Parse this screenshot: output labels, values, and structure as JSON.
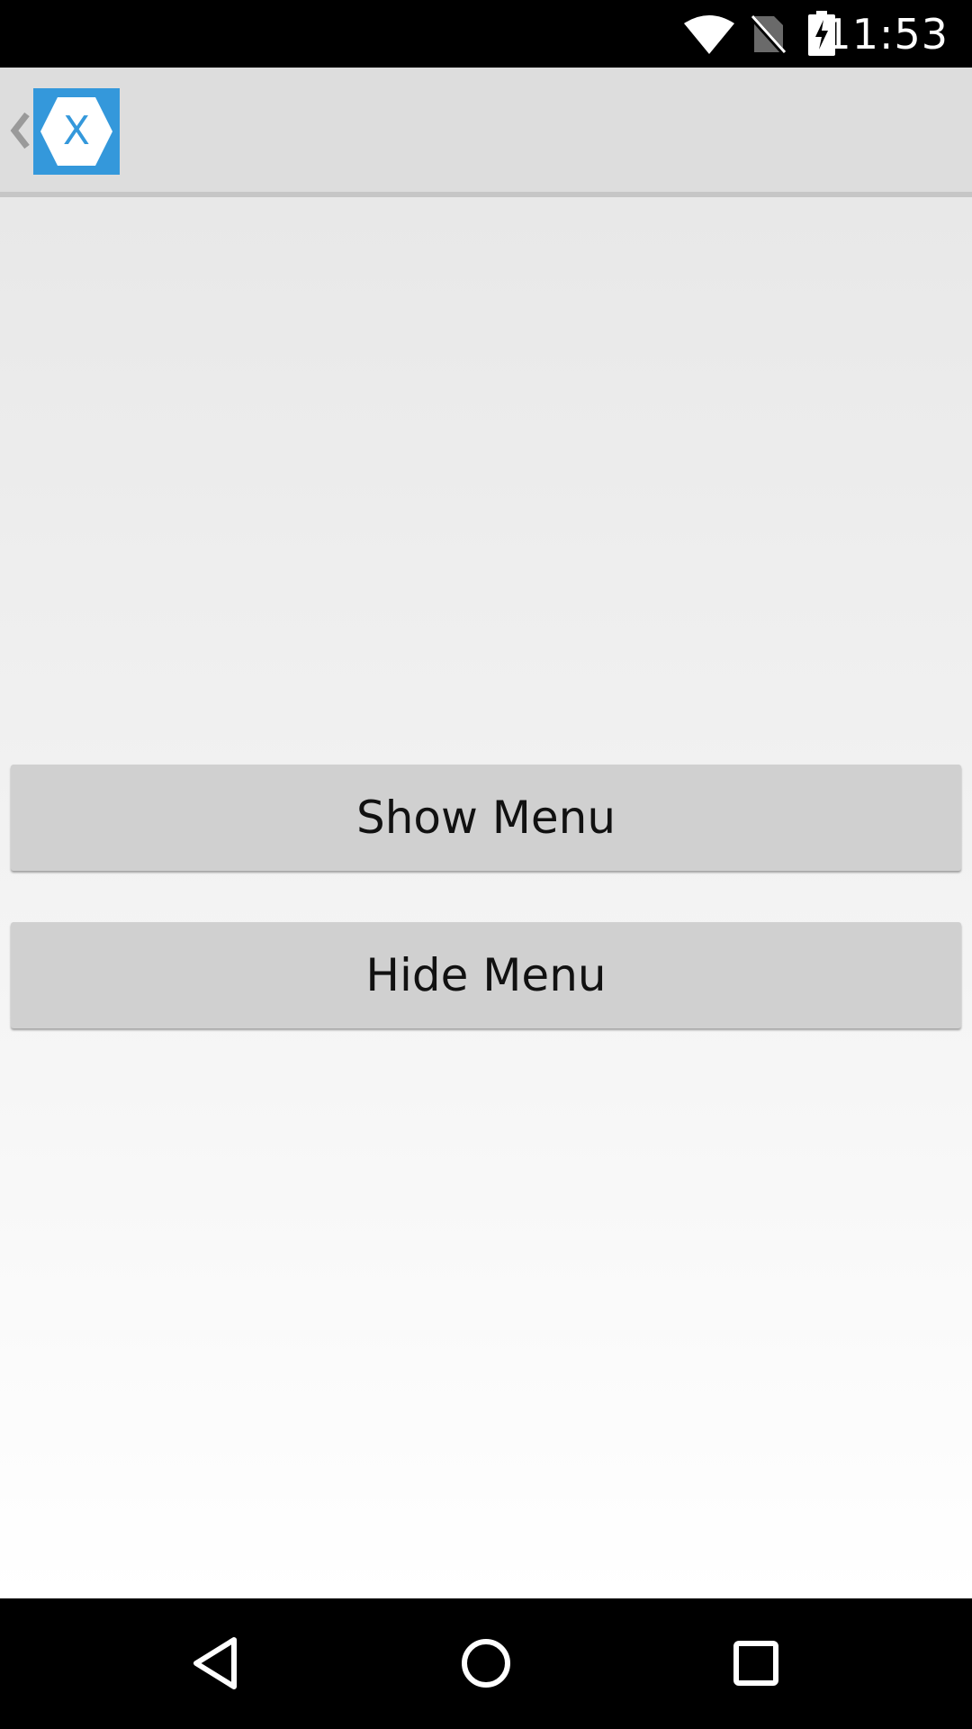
{
  "status_bar": {
    "time": "11:53",
    "icons": [
      "wifi-icon",
      "no-sim-icon",
      "battery-charging-icon"
    ]
  },
  "action_bar": {
    "up_icon": "chevron-left-icon",
    "app_icon": "xamarin-logo-icon",
    "logo_letter": "X",
    "brand_color": "#3498db"
  },
  "main": {
    "show_menu_label": "Show Menu",
    "hide_menu_label": "Hide Menu"
  },
  "nav_bar": {
    "items": [
      "back-icon",
      "home-icon",
      "recents-icon"
    ]
  }
}
